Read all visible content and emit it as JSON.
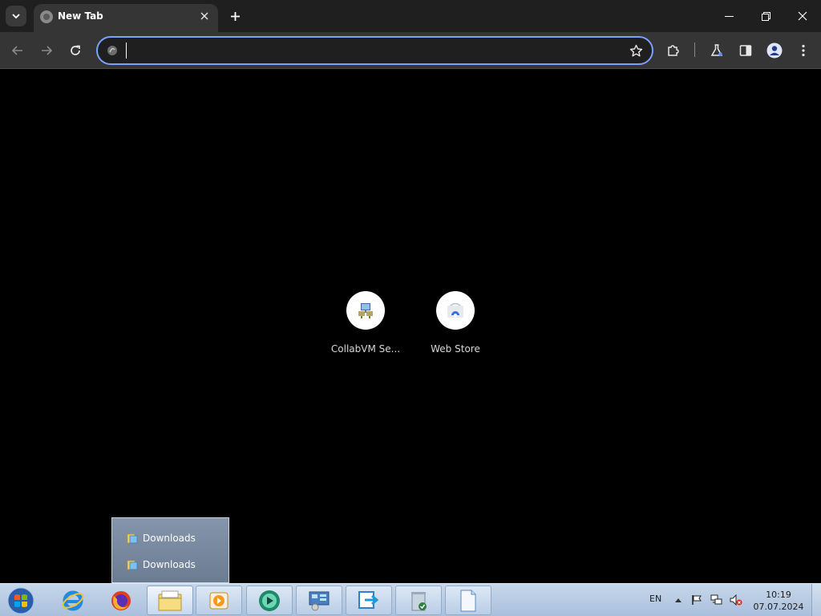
{
  "tab": {
    "title": "New Tab"
  },
  "omnibox": {
    "value": "",
    "placeholder": ""
  },
  "shortcuts": [
    {
      "label": "CollabVM Se..."
    },
    {
      "label": "Web Store"
    }
  ],
  "jumplist": {
    "items": [
      {
        "label": "Downloads"
      },
      {
        "label": "Downloads"
      }
    ]
  },
  "taskbar": {
    "language": "EN",
    "time": "10:19",
    "date": "07.07.2024"
  },
  "colors": {
    "omnibox_focus": "#7ca0ff",
    "toolbar_bg": "#353535",
    "tabstrip_bg": "#1f1f1f"
  }
}
